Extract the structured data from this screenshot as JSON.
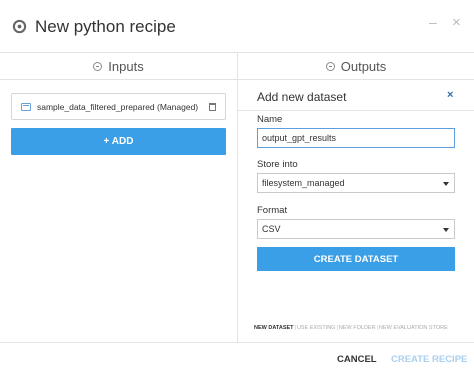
{
  "dialog": {
    "title": "New python recipe",
    "minimize_glyph": "–",
    "close_glyph": "×"
  },
  "columns": {
    "inputs_label": "Inputs",
    "outputs_label": "Outputs"
  },
  "inputs": {
    "items": [
      {
        "label": "sample_data_filtered_prepared (Managed)",
        "icon": "dataset-icon",
        "action_icon": "trash-icon"
      }
    ],
    "add_label": "+ ADD"
  },
  "outputs": {
    "panel_title": "Add new dataset",
    "close_glyph": "×",
    "name_label": "Name",
    "name_value": "output_gpt_results",
    "store_label": "Store into",
    "store_value": "filesystem_managed",
    "format_label": "Format",
    "format_value": "CSV",
    "create_label": "CREATE DATASET",
    "store_tabs": [
      "NEW DATASET",
      "USE EXISTING",
      "NEW FOLDER",
      "NEW EVALUATION STORE"
    ],
    "active_tab": "NEW DATASET"
  },
  "footer": {
    "cancel_label": "CANCEL",
    "create_label": "CREATE RECIPE"
  },
  "colors": {
    "accent": "#3a9fe6",
    "disabled_text": "#a9cfee",
    "close_x": "#2d6da3"
  }
}
